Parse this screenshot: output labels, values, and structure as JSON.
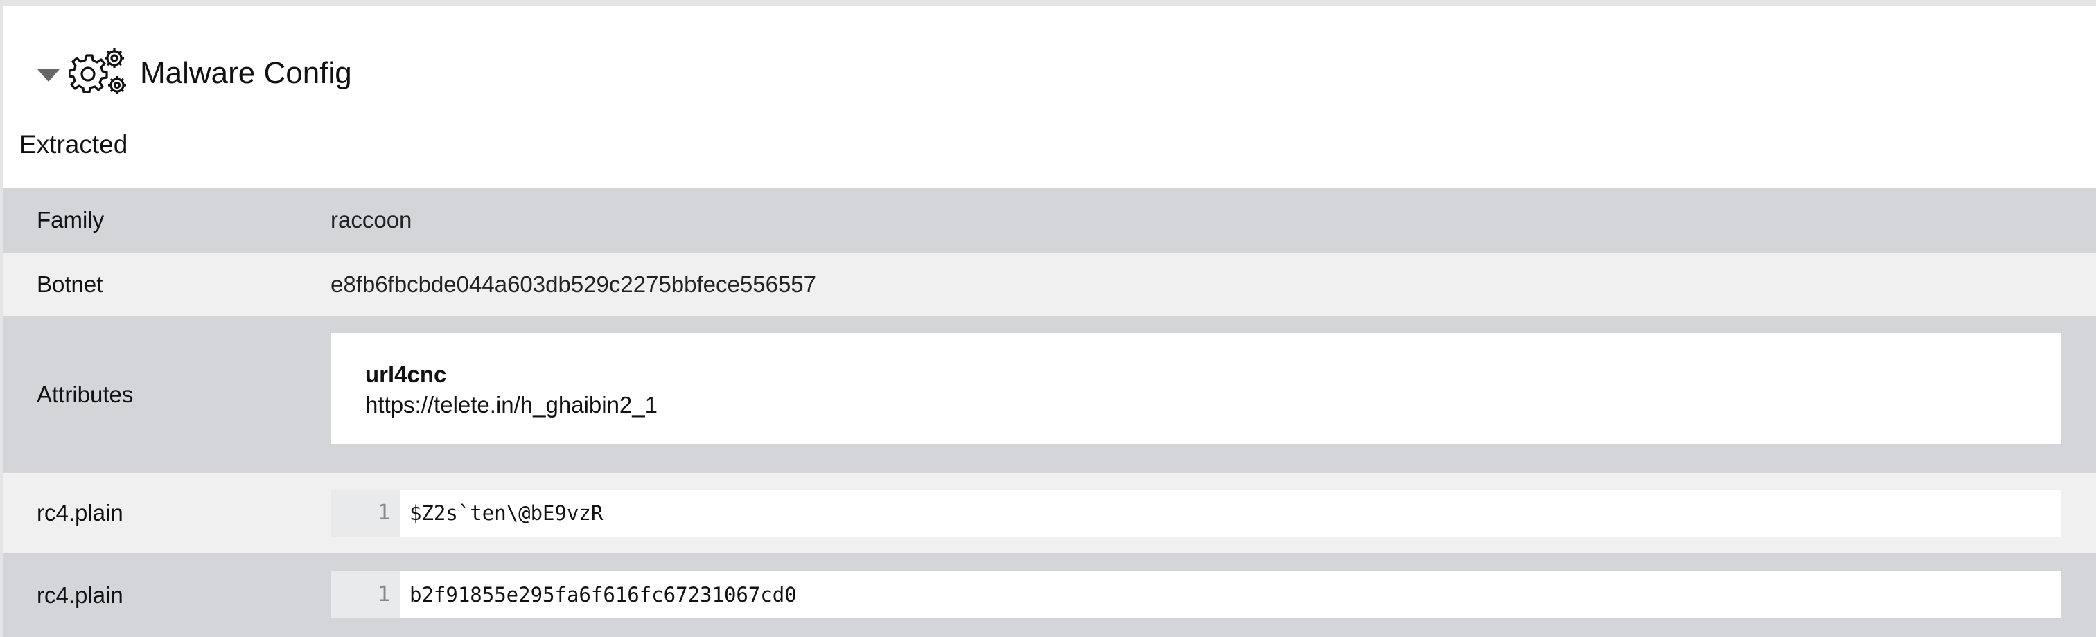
{
  "section": {
    "title": "Malware Config",
    "subtitle": "Extracted"
  },
  "rows": {
    "family": {
      "label": "Family",
      "value": "raccoon"
    },
    "botnet": {
      "label": "Botnet",
      "value": "e8fb6fbcbde044a603db529c2275bbfece556557"
    },
    "attributes": {
      "label": "Attributes",
      "key": "url4cnc",
      "value": "https://telete.in/h_ghaibin2_1"
    },
    "rc4_1": {
      "label": "rc4.plain",
      "line": "1",
      "code": "$Z2s`ten\\@bE9vzR"
    },
    "rc4_2": {
      "label": "rc4.plain",
      "line": "1",
      "code": "b2f91855e295fa6f616fc67231067cd0"
    }
  },
  "icons": {
    "collapse": "caret-down-icon",
    "section": "gears-icon"
  },
  "colors": {
    "row_dark": "#d4d5d8",
    "row_light": "#f0f0f0",
    "gutter": "#e9eaec"
  }
}
